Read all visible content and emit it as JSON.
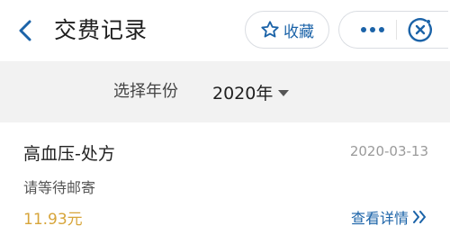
{
  "header": {
    "title": "交费记录",
    "favorite_label": "收藏"
  },
  "filter": {
    "label": "选择年份",
    "selected_year": "2020年"
  },
  "records": [
    {
      "name": "高血压-处方",
      "date": "2020-03-13",
      "status": "请等待邮寄",
      "amount": "11.93元",
      "detail_label": "查看详情"
    }
  ],
  "colors": {
    "accent": "#1b63a8",
    "amount": "#d7a53a",
    "background": "#f2f2f2"
  },
  "icons": [
    "back-arrow-icon",
    "star-outline-icon",
    "more-dots-icon",
    "close-circle-icon",
    "double-chevron-right-icon"
  ]
}
